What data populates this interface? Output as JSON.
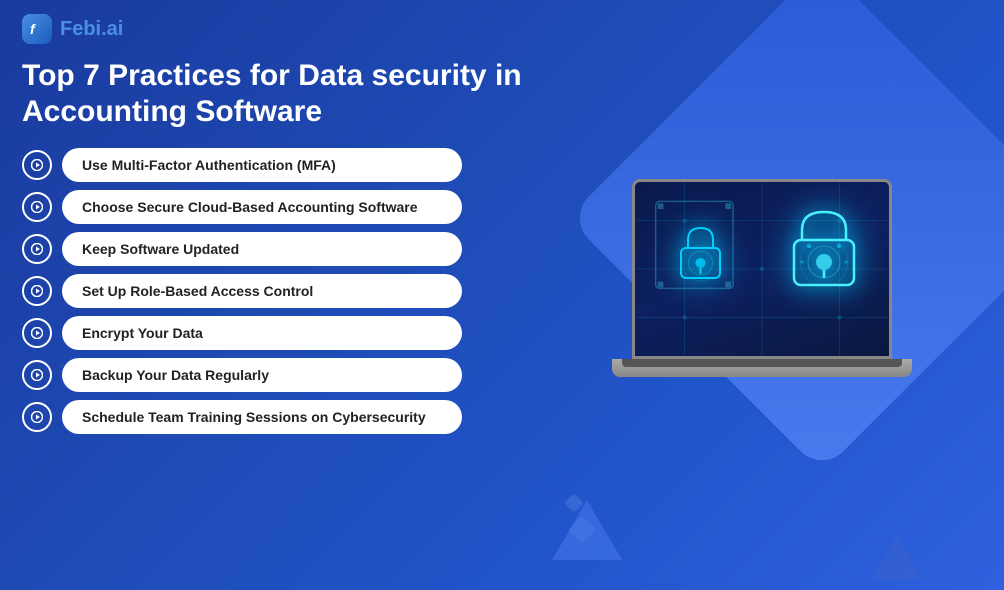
{
  "logo": {
    "icon_text": "f",
    "text": "Febi.ai"
  },
  "main_title": "Top 7 Practices for Data security in Accounting Software",
  "practices": [
    {
      "id": 1,
      "label": "Use Multi-Factor Authentication (MFA)"
    },
    {
      "id": 2,
      "label": "Choose Secure Cloud-Based Accounting Software"
    },
    {
      "id": 3,
      "label": "Keep Software Updated"
    },
    {
      "id": 4,
      "label": "Set Up Role-Based Access Control"
    },
    {
      "id": 5,
      "label": "Encrypt Your Data"
    },
    {
      "id": 6,
      "label": "Backup Your Data Regularly"
    },
    {
      "id": 7,
      "label": "Schedule Team Training Sessions on Cybersecurity"
    }
  ],
  "colors": {
    "bg_start": "#1a3a9e",
    "bg_end": "#3060dd",
    "accent": "#4a90e2",
    "white": "#ffffff",
    "label_bg": "#ffffff",
    "label_text": "#222222",
    "lock_glow": "#00cfff"
  }
}
